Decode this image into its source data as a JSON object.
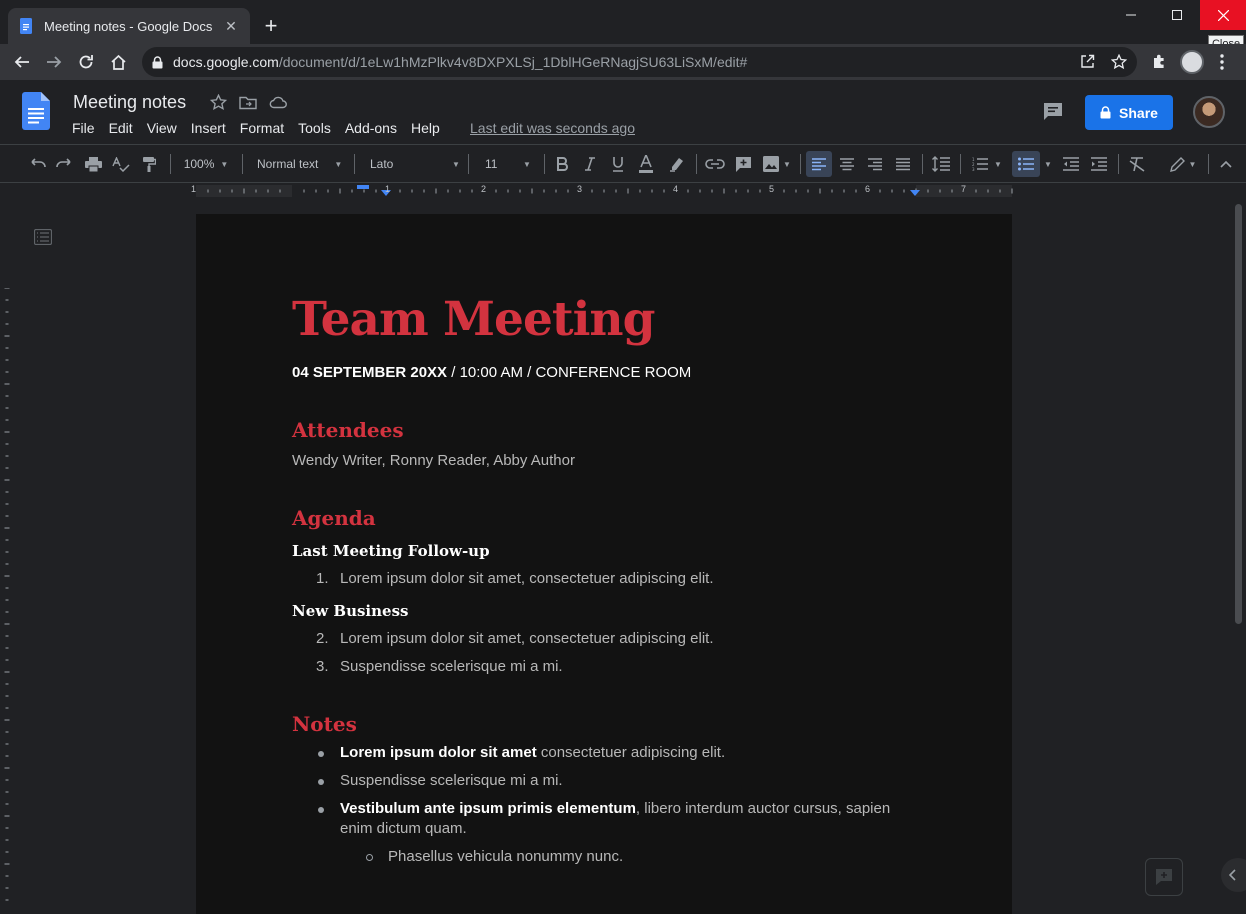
{
  "browser": {
    "tab_title": "Meeting notes - Google Docs",
    "tab_close": "✕",
    "new_tab": "+",
    "tooltip": "Close",
    "url_host": "docs.google.com",
    "url_path": "/document/d/1eLw1hMzPlkv4v8DXPXLSj_1DblHGeRNagjSU63LiSxM/edit#"
  },
  "docs": {
    "title": "Meeting notes",
    "menu": [
      "File",
      "Edit",
      "View",
      "Insert",
      "Format",
      "Tools",
      "Add-ons",
      "Help"
    ],
    "last_edit": "Last edit was seconds ago",
    "share_label": "Share"
  },
  "toolbar": {
    "zoom": "100%",
    "style": "Normal text",
    "font": "Lato",
    "size": "11"
  },
  "ruler": {
    "labels": [
      "1",
      "1",
      "2",
      "3",
      "4",
      "5",
      "6",
      "7"
    ]
  },
  "document": {
    "title": "Team Meeting",
    "subtitle_bold": "04 SEPTEMBER 20XX",
    "subtitle_rest": " / 10:00 AM / CONFERENCE ROOM",
    "attendees_heading": "Attendees",
    "attendees": "Wendy Writer, Ronny Reader, Abby Author",
    "agenda_heading": "Agenda",
    "followup_heading": "Last Meeting Follow-up",
    "followup_items": [
      {
        "num": "1.",
        "text": "Lorem ipsum dolor sit amet, consectetuer adipiscing elit."
      }
    ],
    "newbiz_heading": "New Business",
    "newbiz_items": [
      {
        "num": "2.",
        "text": "Lorem ipsum dolor sit amet, consectetuer adipiscing elit."
      },
      {
        "num": "3.",
        "text": "Suspendisse scelerisque mi a mi."
      }
    ],
    "notes_heading": "Notes",
    "notes": [
      {
        "bold": "Lorem ipsum dolor sit amet",
        "text": " consectetuer adipiscing elit."
      },
      {
        "bold": "",
        "text": "Suspendisse scelerisque mi a mi."
      },
      {
        "bold": "Vestibulum ante ipsum primis elementum",
        "text": ", libero interdum auctor cursus, sapien enim dictum quam."
      }
    ],
    "subnote": "Phasellus vehicula nonummy nunc."
  },
  "colors": {
    "accent_red": "#d3333f",
    "share_blue": "#1a73e8",
    "close_red": "#e81123"
  }
}
